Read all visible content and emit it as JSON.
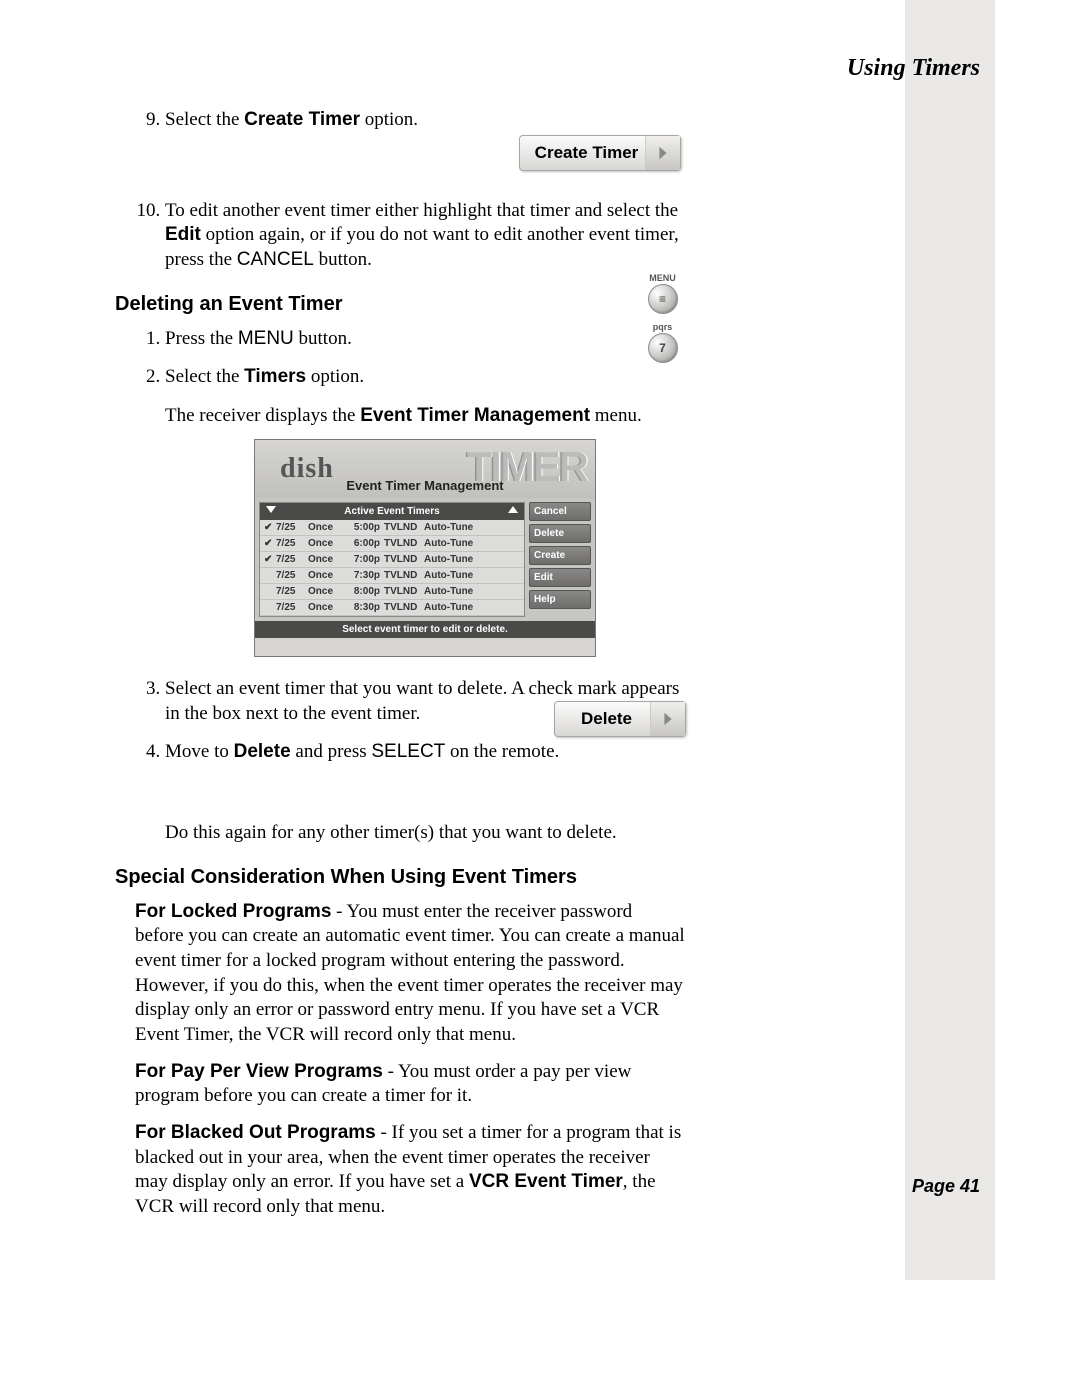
{
  "header": {
    "title": "Using Timers",
    "page_label": "Page 41"
  },
  "buttons": {
    "create_timer": "Create Timer",
    "delete": "Delete"
  },
  "remote": {
    "menu_label": "MENU",
    "menu_glyph": "≡",
    "pqrs_label": "pqrs",
    "pqrs_glyph": "7"
  },
  "steps_a": {
    "s9_pre": "Select the ",
    "s9_bold": "Create Timer",
    "s9_post": " option.",
    "s10_pre": "To edit another event timer either highlight that timer and select the ",
    "s10_bold": "Edit",
    "s10_mid": " option again, or if you do not want to edit another event timer, press the ",
    "s10_sans": "CANCEL",
    "s10_end": " button."
  },
  "sections": {
    "deleting_h": "Deleting an Event Timer",
    "d1_pre": "Press the ",
    "d1_sans": "MENU",
    "d1_post": " button.",
    "d2_pre": "Select the ",
    "d2_bold": "Timers",
    "d2_post": " option.",
    "d_display_pre": "The receiver displays the ",
    "d_display_bold": "Event Timer Management",
    "d_display_post": " menu.",
    "d3": "Select an event timer that you want to delete. A check mark appears in the box next to the event timer.",
    "d4_pre": "Move to ",
    "d4_bold": "Delete",
    "d4_mid": " and press ",
    "d4_sans": "SELECT",
    "d4_post": " on the remote.",
    "d_again": "Do this again for any other timer(s) that you want to delete.",
    "special_h": "Special Consideration When Using Event Timers",
    "locked_bold": "For Locked Programs",
    "locked_body": " - You must enter the receiver password before you can create an automatic event timer. You can create a manual event timer for a locked program without entering the password. However, if you do this, when the event timer operates the receiver may display only an error or password entry menu. If you have set a VCR Event Timer, the VCR will record only that menu.",
    "ppv_bold": "For Pay Per View Programs",
    "ppv_body": " - You must order a pay per view program before you can create a timer for it.",
    "black_bold": "For Blacked Out Programs",
    "black_body_a": " - If you set a timer for a program that is blacked out in your area, when the event timer operates the receiver may display only an error. If you have set a ",
    "black_bold2": "VCR Event Timer",
    "black_body_b": ", the VCR will record only that menu."
  },
  "timer_shot": {
    "logo": "dish",
    "big": "TIMER",
    "subtitle": "Event Timer Management",
    "list_header": "Active Event Timers",
    "footer": "Select event timer to edit or delete.",
    "buttons": {
      "cancel": "Cancel",
      "delete": "Delete",
      "create": "Create",
      "edit": "Edit",
      "help": "Help"
    },
    "rows": [
      {
        "chk": "✔",
        "date": "7/25",
        "freq": "Once",
        "time": "5:00p",
        "ch": "TVLND",
        "act": "Auto-Tune"
      },
      {
        "chk": "✔",
        "date": "7/25",
        "freq": "Once",
        "time": "6:00p",
        "ch": "TVLND",
        "act": "Auto-Tune"
      },
      {
        "chk": "✔",
        "date": "7/25",
        "freq": "Once",
        "time": "7:00p",
        "ch": "TVLND",
        "act": "Auto-Tune"
      },
      {
        "chk": "",
        "date": "7/25",
        "freq": "Once",
        "time": "7:30p",
        "ch": "TVLND",
        "act": "Auto-Tune"
      },
      {
        "chk": "",
        "date": "7/25",
        "freq": "Once",
        "time": "8:00p",
        "ch": "TVLND",
        "act": "Auto-Tune"
      },
      {
        "chk": "",
        "date": "7/25",
        "freq": "Once",
        "time": "8:30p",
        "ch": "TVLND",
        "act": "Auto-Tune"
      }
    ]
  }
}
